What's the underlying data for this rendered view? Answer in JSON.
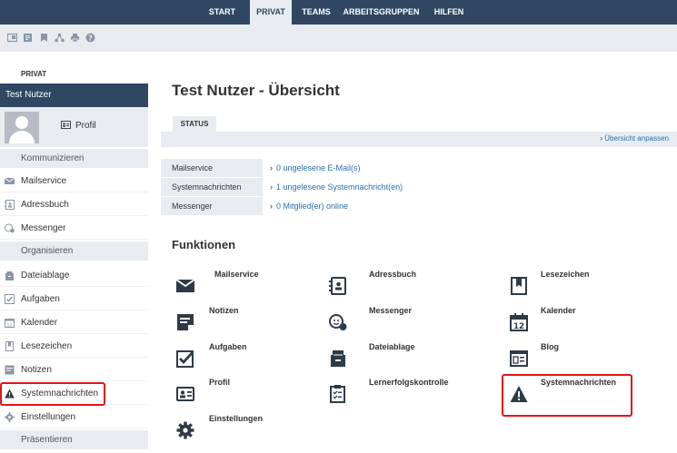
{
  "topnav": {
    "tabs": [
      {
        "label": "START",
        "active": false
      },
      {
        "label": "PRIVAT",
        "active": true
      },
      {
        "label": "TEAMS",
        "active": false
      },
      {
        "label": "ARBEITSGRUPPEN",
        "active": false
      },
      {
        "label": "HILFEN",
        "active": false
      }
    ]
  },
  "toolbar": {
    "icons": [
      "window-icon",
      "list-icon",
      "bookmark-icon",
      "network-icon",
      "print-icon",
      "help-icon"
    ]
  },
  "sidebar": {
    "heading": "PRIVAT",
    "user": "Test Nutzer",
    "profile_label": "Profil",
    "groups": {
      "kommunizieren": "Kommunizieren",
      "organisieren": "Organisieren",
      "praesentieren": "Präsentieren"
    },
    "items": {
      "mailservice": "Mailservice",
      "adressbuch": "Adressbuch",
      "messenger": "Messenger",
      "dateiablage": "Dateiablage",
      "aufgaben": "Aufgaben",
      "kalender": "Kalender",
      "lesezeichen": "Lesezeichen",
      "notizen": "Notizen",
      "systemnachrichten": "Systemnachrichten",
      "einstellungen": "Einstellungen"
    }
  },
  "main": {
    "title": "Test Nutzer - Übersicht",
    "status_tab": "STATUS",
    "adjust_link": "Übersicht anpassen",
    "status_rows": [
      {
        "label": "Mailservice",
        "value": "0 ungelesene E-Mail(s)"
      },
      {
        "label": "Systemnachrichten",
        "value": "1 ungelesene Systemnachricht(en)"
      },
      {
        "label": "Messenger",
        "value": "0 Mitglied(er) online"
      }
    ],
    "functions_title": "Funktionen",
    "functions": {
      "mailservice": "Mailservice",
      "adressbuch": "Adressbuch",
      "lesezeichen": "Lesezeichen",
      "notizen": "Notizen",
      "messenger": "Messenger",
      "kalender": "Kalender",
      "aufgaben": "Aufgaben",
      "dateiablage": "Dateiablage",
      "blog": "Blog",
      "profil": "Profil",
      "lernerfolgskontrolle": "Lernerfolgskontrolle",
      "systemnachrichten": "Systemnachrichten",
      "einstellungen": "Einstellungen"
    }
  },
  "colors": {
    "nav": "#2f4763",
    "panel": "#e8ecf1",
    "link": "#2a6fad",
    "highlight": "#e3151a",
    "icon": "#2f3a47"
  }
}
